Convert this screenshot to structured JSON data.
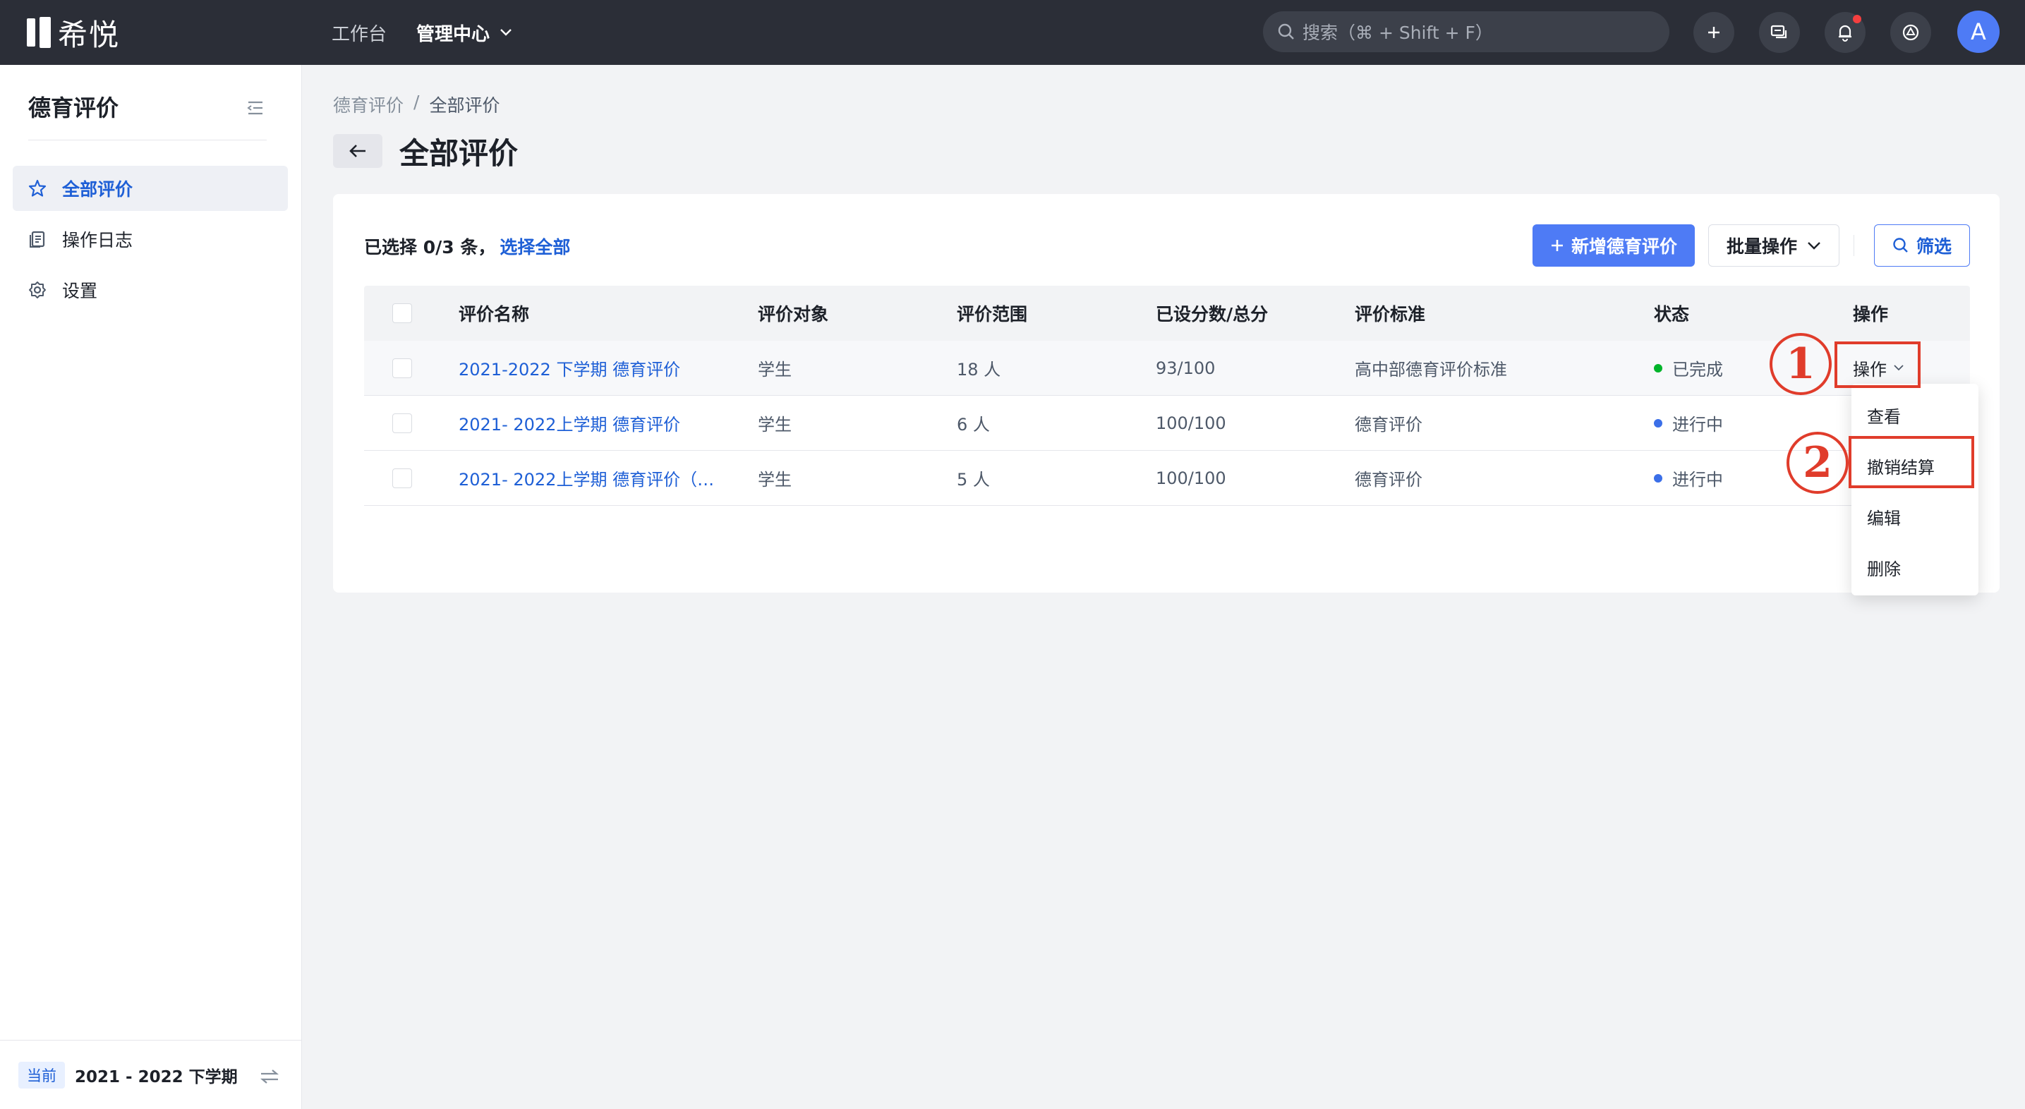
{
  "app": {
    "logo_text": "希悦"
  },
  "topnav": {
    "items": [
      {
        "label": "工作台"
      },
      {
        "label": "管理中心"
      }
    ]
  },
  "search": {
    "placeholder": "搜索（⌘ + Shift + F）"
  },
  "top_icons": [
    "plus-icon",
    "chat-icon",
    "bell-icon",
    "settings-icon"
  ],
  "avatar": {
    "initial": "A"
  },
  "sidebar": {
    "title": "德育评价",
    "items": [
      {
        "label": "全部评价",
        "icon": "star-icon",
        "active": true
      },
      {
        "label": "操作日志",
        "icon": "document-icon",
        "active": false
      },
      {
        "label": "设置",
        "icon": "gear-icon",
        "active": false
      }
    ],
    "footer": {
      "badge": "当前",
      "term": "2021 - 2022 下学期"
    }
  },
  "breadcrumb": {
    "items": [
      "德育评价",
      "/",
      "全部评价"
    ]
  },
  "page": {
    "title": "全部评价"
  },
  "toolbar": {
    "selected_prefix": "已选择 0/3 条，",
    "select_all": "选择全部",
    "add_label": "新增德育评价",
    "batch_label": "批量操作",
    "filter_label": "筛选"
  },
  "table": {
    "columns": [
      "评价名称",
      "评价对象",
      "评价范围",
      "已设分数/总分",
      "评价标准",
      "状态",
      "操作"
    ],
    "rows": [
      {
        "name": "2021-2022 下学期 德育评价",
        "target": "学生",
        "range": "18 人",
        "score": "93/100",
        "standard": "高中部德育评价标准",
        "status": "已完成",
        "status_color": "#00b42a",
        "op": "操作"
      },
      {
        "name": "2021- 2022上学期 德育评价",
        "target": "学生",
        "range": "6 人",
        "score": "100/100",
        "standard": "德育评价",
        "status": "进行中",
        "status_color": "#3b6fe8",
        "op": ""
      },
      {
        "name": "2021- 2022上学期 德育评价（…",
        "target": "学生",
        "range": "5 人",
        "score": "100/100",
        "standard": "德育评价",
        "status": "进行中",
        "status_color": "#3b6fe8",
        "op": ""
      }
    ]
  },
  "dropdown": {
    "items": [
      "查看",
      "撤销结算",
      "编辑",
      "删除"
    ]
  },
  "annotations": {
    "step1": "1",
    "step2": "2",
    "color": "#e03c2b"
  },
  "colors": {
    "topbar": "#2b2e37",
    "primary": "#4e7bf5",
    "link": "#1e5fd6"
  }
}
